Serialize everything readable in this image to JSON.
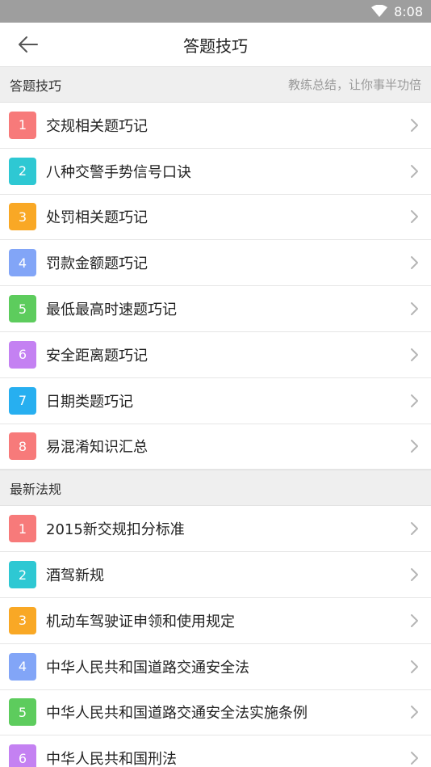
{
  "status_bar": {
    "time": "8:08"
  },
  "app_bar": {
    "title": "答题技巧"
  },
  "sections": [
    {
      "title": "答题技巧",
      "subtitle": "教练总结，让你事半功倍",
      "items": [
        {
          "num": "1",
          "label": "交规相关题巧记",
          "color": "#f77a7a"
        },
        {
          "num": "2",
          "label": "八种交警手势信号口诀",
          "color": "#2ec8d3"
        },
        {
          "num": "3",
          "label": "处罚相关题巧记",
          "color": "#f9a825"
        },
        {
          "num": "4",
          "label": "罚款金额题巧记",
          "color": "#82a5f7"
        },
        {
          "num": "5",
          "label": "最低最高时速题巧记",
          "color": "#5dcc5d"
        },
        {
          "num": "6",
          "label": "安全距离题巧记",
          "color": "#c481f2"
        },
        {
          "num": "7",
          "label": "日期类题巧记",
          "color": "#27aff0"
        },
        {
          "num": "8",
          "label": "易混淆知识汇总",
          "color": "#f77a7a"
        }
      ]
    },
    {
      "title": "最新法规",
      "subtitle": "",
      "items": [
        {
          "num": "1",
          "label": "2015新交规扣分标准",
          "color": "#f77a7a"
        },
        {
          "num": "2",
          "label": "酒驾新规",
          "color": "#2ec8d3"
        },
        {
          "num": "3",
          "label": "机动车驾驶证申领和使用规定",
          "color": "#f9a825"
        },
        {
          "num": "4",
          "label": "中华人民共和国道路交通安全法",
          "color": "#82a5f7"
        },
        {
          "num": "5",
          "label": "中华人民共和国道路交通安全法实施条例",
          "color": "#5dcc5d"
        },
        {
          "num": "6",
          "label": "中华人民共和国刑法",
          "color": "#c481f2"
        }
      ]
    }
  ]
}
